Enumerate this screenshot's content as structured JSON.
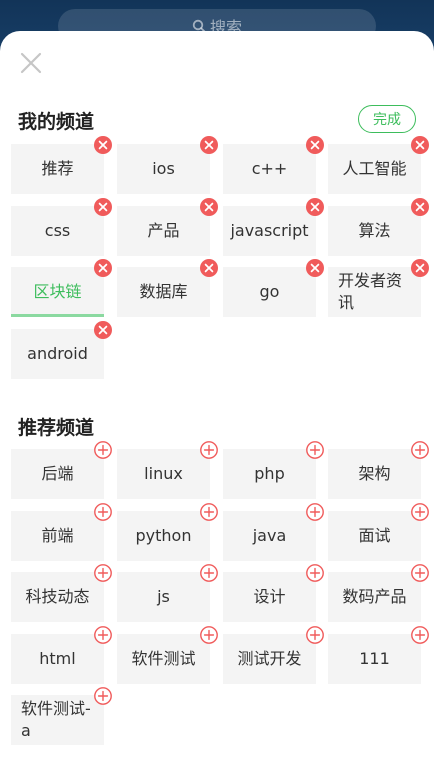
{
  "search": {
    "label": "搜索"
  },
  "my_channels": {
    "title": "我的频道",
    "done_label": "完成",
    "items": [
      {
        "label": "推荐"
      },
      {
        "label": "ios"
      },
      {
        "label": "c++"
      },
      {
        "label": "人工智能"
      },
      {
        "label": "css"
      },
      {
        "label": "产品"
      },
      {
        "label": "javascript"
      },
      {
        "label": "算法"
      },
      {
        "label": "区块链",
        "active": true
      },
      {
        "label": "数据库"
      },
      {
        "label": "go"
      },
      {
        "label": "开发者资讯"
      },
      {
        "label": "android"
      }
    ]
  },
  "recommended_channels": {
    "title": "推荐频道",
    "items": [
      {
        "label": "后端"
      },
      {
        "label": "linux"
      },
      {
        "label": "php"
      },
      {
        "label": "架构"
      },
      {
        "label": "前端"
      },
      {
        "label": "python"
      },
      {
        "label": "java"
      },
      {
        "label": "面试"
      },
      {
        "label": "科技动态"
      },
      {
        "label": "js"
      },
      {
        "label": "设计"
      },
      {
        "label": "数码产品"
      },
      {
        "label": "html"
      },
      {
        "label": "软件测试"
      },
      {
        "label": "测试开发"
      },
      {
        "label": "111"
      },
      {
        "label": "软件测试-a"
      }
    ]
  },
  "colors": {
    "accent": "#3dbd5c",
    "delete_badge": "#f05b5b",
    "add_badge": "#f05b5b",
    "tile_bg": "#f4f4f4"
  },
  "icons": {
    "close": "close-icon",
    "search": "search-icon",
    "delete": "delete-x-circle-icon",
    "add": "add-plus-circle-icon"
  }
}
